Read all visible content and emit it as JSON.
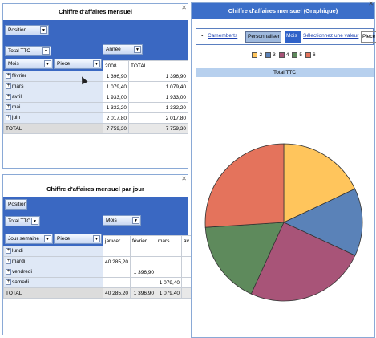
{
  "top_panel": {
    "title": "Chiffre d'affaires mensuel",
    "filter_chip": "Position",
    "measure_chip": "Total TTC",
    "column_chip": "Année",
    "row_chip_1": "Mois",
    "row_chip_2": "Piece",
    "col_header_year": "2008",
    "col_header_total": "TOTAL",
    "rows": [
      {
        "label": "février",
        "v1": "1 396,90",
        "v2": "1 396,90"
      },
      {
        "label": "mars",
        "v1": "1 079,40",
        "v2": "1 079,40"
      },
      {
        "label": "avril",
        "v1": "1 933,00",
        "v2": "1 933,00"
      },
      {
        "label": "mai",
        "v1": "1 332,20",
        "v2": "1 332,20"
      },
      {
        "label": "juin",
        "v1": "2 017,80",
        "v2": "2 017,80"
      }
    ],
    "total": {
      "label": "TOTAL",
      "v1": "7 759,30",
      "v2": "7 759,30"
    }
  },
  "bottom_panel": {
    "title": "Chiffre d'affaires mensuel par jour",
    "filter_chip": "Position",
    "measure_chip": "Total TTC",
    "column_chip": "Mois",
    "row_chip_1": "Jour semaine",
    "row_chip_2": "Piece",
    "col_headers": [
      "janvier",
      "février",
      "mars",
      "av"
    ],
    "rows": [
      {
        "label": "lundi",
        "c": [
          "",
          "",
          "",
          ""
        ]
      },
      {
        "label": "mardi",
        "c": [
          "40 285,20",
          "",
          "",
          ""
        ]
      },
      {
        "label": "vendredi",
        "c": [
          "",
          "1 396,90",
          "",
          ""
        ]
      },
      {
        "label": "samedi",
        "c": [
          "",
          "",
          "1 079,40",
          ""
        ]
      }
    ],
    "total": {
      "label": "TOTAL",
      "c": [
        "40 285,20",
        "1 396,90",
        "1 079,40",
        ""
      ]
    }
  },
  "right_panel": {
    "title": "Chiffre d'affaires mensuel (Graphique)",
    "toolbar": {
      "chart_type": "Camemberts",
      "customize": "Personnaliser",
      "mois": "Mois",
      "select_value": "Sélectionnez une valeur",
      "piece": "Piece"
    },
    "total_label": "Total TTC"
  },
  "colors": {
    "accent_blue": "#3a68c2",
    "title_bar": "#3c6fc9"
  },
  "chart_data": {
    "type": "pie",
    "legend": [
      "2",
      "3",
      "4",
      "5",
      "6"
    ],
    "colors": [
      "#ffc55c",
      "#5a82b8",
      "#a85478",
      "#5e8a5c",
      "#e4735c"
    ],
    "values": [
      1396.9,
      1079.4,
      1933.0,
      1332.2,
      2017.8
    ]
  }
}
